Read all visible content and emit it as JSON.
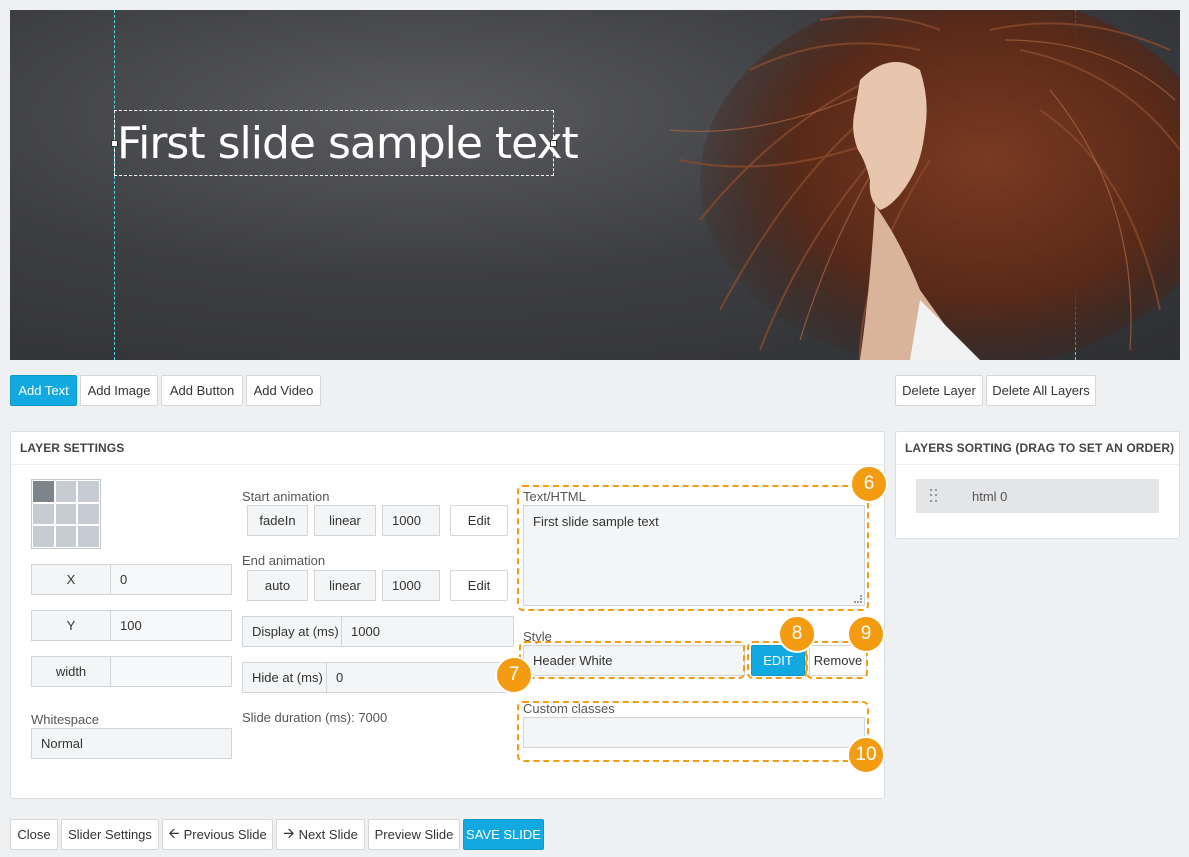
{
  "slide": {
    "layer_text": "First slide sample text"
  },
  "toolbar": {
    "add_text": "Add Text",
    "add_image": "Add Image",
    "add_button": "Add Button",
    "add_video": "Add Video",
    "delete_layer": "Delete Layer",
    "delete_all_layers": "Delete All Layers"
  },
  "layer_settings": {
    "title": "LAYER SETTINGS",
    "x_label": "X",
    "x_value": "0",
    "y_label": "Y",
    "y_value": "100",
    "width_label": "width",
    "width_value": "",
    "whitespace_label": "Whitespace",
    "whitespace_value": "Normal",
    "start_animation_label": "Start animation",
    "start_animation": {
      "effect": "fadeIn",
      "easing": "linear",
      "duration": "1000",
      "edit": "Edit"
    },
    "end_animation_label": "End animation",
    "end_animation": {
      "effect": "auto",
      "easing": "linear",
      "duration": "1000",
      "edit": "Edit"
    },
    "display_at_label": "Display at (ms)",
    "display_at_value": "1000",
    "hide_at_label": "Hide at (ms)",
    "hide_at_value": "0",
    "slide_duration": "Slide duration (ms): 7000",
    "text_html_label": "Text/HTML",
    "text_html_value": "First slide sample text",
    "style_label": "Style",
    "style_value": "Header White",
    "style_edit": "EDIT",
    "style_remove": "Remove",
    "custom_classes_label": "Custom classes",
    "custom_classes_value": ""
  },
  "callouts": [
    "6",
    "7",
    "8",
    "9",
    "10"
  ],
  "layers_sorting": {
    "title": "LAYERS SORTING (DRAG TO SET AN ORDER)",
    "items": [
      {
        "label": "html 0"
      }
    ]
  },
  "footer": {
    "close": "Close",
    "slider_settings": "Slider Settings",
    "previous_slide": "Previous Slide",
    "next_slide": "Next Slide",
    "preview_slide": "Preview Slide",
    "save_slide": "SAVE SLIDE"
  },
  "colors": {
    "accent": "#12a9e1",
    "callout": "#f39c12",
    "guide": "#4fd6e0"
  }
}
